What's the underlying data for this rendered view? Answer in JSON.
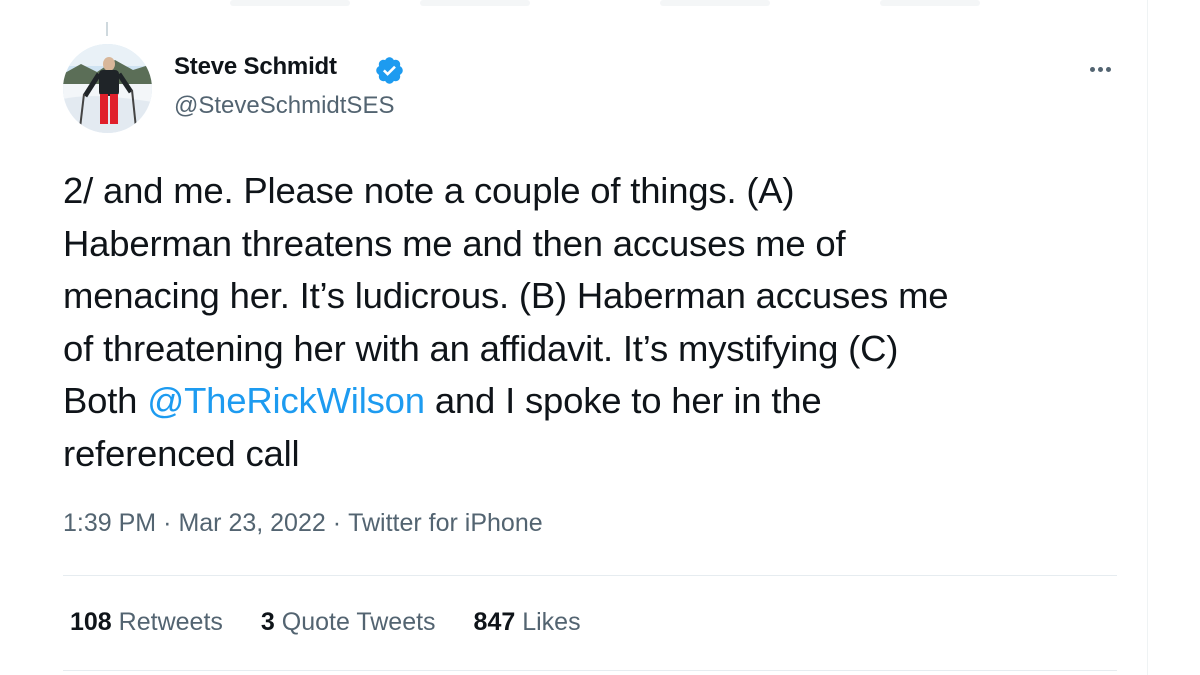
{
  "author": {
    "display_name": "Steve Schmidt",
    "handle": "@SteveSchmidtSES",
    "verified_icon": "verified-badge-icon",
    "avatar_icon": "avatar-photo"
  },
  "more_icon": "more-options-icon",
  "tweet": {
    "lines": [
      "2/ and me. Please note a couple of things. (A)",
      "Haberman threatens me and then accuses me of",
      "menacing her. It’s ludicrous. (B) Haberman accuses me",
      "of threatening her with an affidavit. It’s mystifying (C)",
      "and I spoke to her in the",
      "referenced call"
    ],
    "line5_prefix": "Both ",
    "mention": "@TheRickWilson"
  },
  "meta": {
    "time": "1:39 PM",
    "separator": "·",
    "date": "Mar 23, 2022",
    "source": "Twitter for iPhone"
  },
  "stats": {
    "retweets_count": "108",
    "retweets_label": "Retweets",
    "quotes_count": "3",
    "quotes_label": "Quote Tweets",
    "likes_count": "847",
    "likes_label": "Likes"
  },
  "colors": {
    "link": "#1d9bf0",
    "secondary_text": "#536471",
    "primary_text": "#0f1419"
  }
}
